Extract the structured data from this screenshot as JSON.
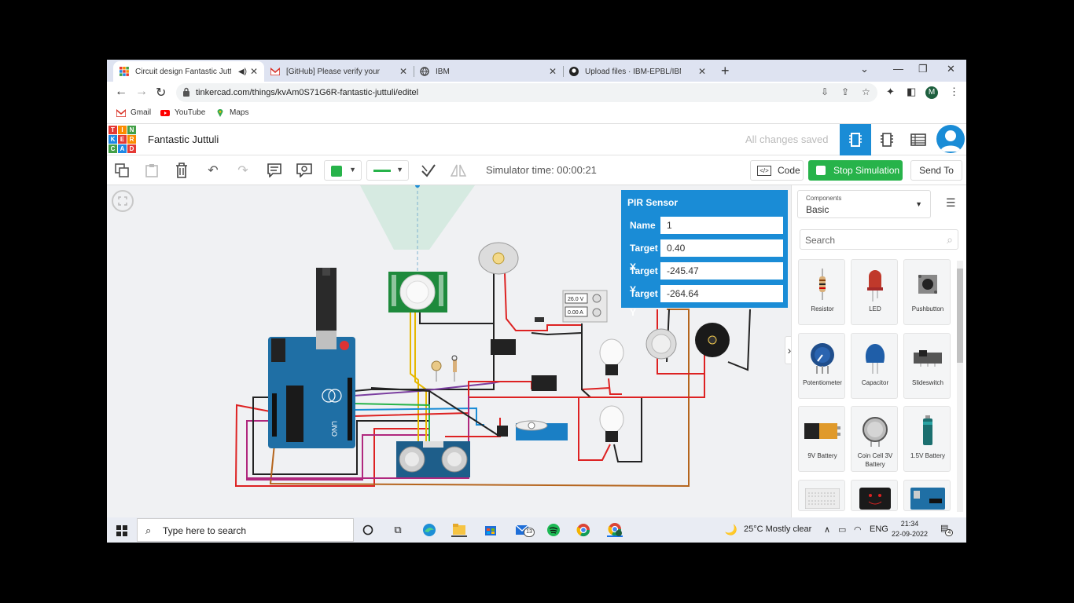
{
  "browser": {
    "tabs": [
      {
        "label": "Circuit design Fantastic Juttuli",
        "icon": "tinkercad-icon",
        "active": true
      },
      {
        "label": "[GitHub] Please verify your device",
        "icon": "gmail-icon",
        "active": false
      },
      {
        "label": "IBM",
        "icon": "globe-icon",
        "active": false
      },
      {
        "label": "Upload files · IBM-EPBL/IBM-Proj",
        "icon": "github-icon",
        "active": false
      }
    ],
    "url": "tinkercad.com/things/kvAm0S71G6R-fantastic-juttuli/editel",
    "profile_initial": "M",
    "bookmarks": [
      {
        "label": "Gmail",
        "icon": "gmail-icon"
      },
      {
        "label": "YouTube",
        "icon": "youtube-icon"
      },
      {
        "label": "Maps",
        "icon": "maps-icon"
      }
    ]
  },
  "app": {
    "logo_letters": [
      "T",
      "I",
      "N",
      "K",
      "E",
      "R",
      "C",
      "A",
      "D"
    ],
    "project_title": "Fantastic Juttuli",
    "save_status": "All changes saved"
  },
  "toolbar": {
    "simulator_time": "Simulator time: 00:00:21",
    "code_label": "Code",
    "code_icon_text": "</>",
    "stop_label": "Stop Simulation",
    "send_label": "Send To",
    "fill_color": "#27b34a",
    "wire_color": "#27b34a"
  },
  "inspector": {
    "title": "PIR Sensor",
    "fields": [
      {
        "label": "Name",
        "value": "1"
      },
      {
        "label": "Target X",
        "value": "0.40"
      },
      {
        "label": "Target Y",
        "value": "-245.47"
      },
      {
        "label": "Target Y",
        "value": "-264.64"
      }
    ]
  },
  "circuit_labels": {
    "arduino_brand": "UNO",
    "power_voltage": "26.0 V",
    "power_current": "0.00 A"
  },
  "components_panel": {
    "select_label": "Components",
    "select_value": "Basic",
    "search_placeholder": "Search",
    "items": [
      {
        "label": "Resistor"
      },
      {
        "label": "LED"
      },
      {
        "label": "Pushbutton"
      },
      {
        "label": "Potentiometer"
      },
      {
        "label": "Capacitor"
      },
      {
        "label": "Slideswitch"
      },
      {
        "label": "9V Battery"
      },
      {
        "label": "Coin Cell 3V Battery"
      },
      {
        "label": "1.5V Battery"
      }
    ]
  },
  "taskbar": {
    "search_placeholder": "Type here to search",
    "mail_badge": "13",
    "weather": "25°C  Mostly clear",
    "language": "ENG",
    "time": "21:34",
    "date": "22-09-2022",
    "notification_count": "4"
  }
}
